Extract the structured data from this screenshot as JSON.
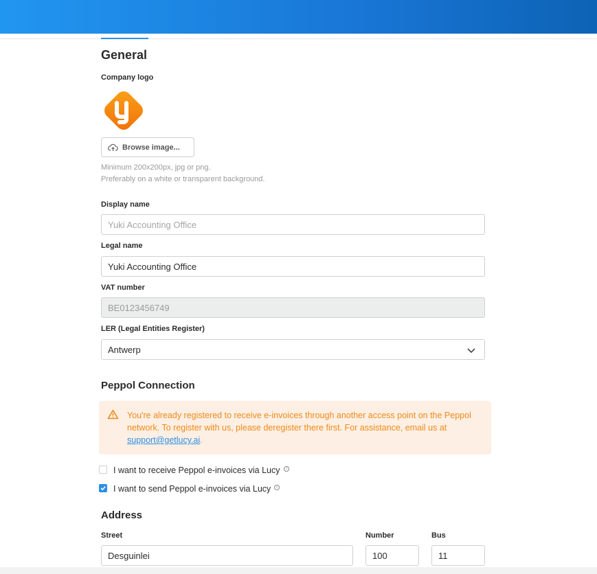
{
  "general": {
    "title": "General",
    "company_logo_label": "Company logo",
    "browse_label": "Browse image...",
    "hint_line1": "Minimum 200x200px, jpg or png.",
    "hint_line2": "Preferably on a white or transparent background.",
    "display_name": {
      "label": "Display name",
      "value": "",
      "placeholder": "Yuki Accounting Office"
    },
    "legal_name": {
      "label": "Legal name",
      "value": "Yuki Accounting Office"
    },
    "vat_number": {
      "label": "VAT number",
      "value": "BE0123456749"
    },
    "ler": {
      "label": "LER (Legal Entities Register)",
      "selected": "Antwerp"
    }
  },
  "peppol": {
    "title": "Peppol Connection",
    "warning_line1": "You're already registered to receive e-invoices through another access point on the Peppol",
    "warning_line2": "network. To register with us, please deregister there first. For assistance, email us at",
    "warning_link": "support@getlucy.ai",
    "warning_suffix": ".",
    "receive_label": "I want to receive Peppol e-invoices via Lucy",
    "receive_checked": false,
    "send_label": "I want to send Peppol e-invoices via Lucy",
    "send_checked": true
  },
  "address": {
    "title": "Address",
    "street_label": "Street",
    "street_value": "Desguinlei",
    "number_label": "Number",
    "number_value": "100",
    "bus_label": "Bus",
    "bus_value": "11"
  },
  "icons": {
    "logo": "yuki-logo",
    "upload": "cloud-upload-icon",
    "warning": "warning-triangle-icon",
    "info": "info-icon",
    "chevron": "chevron-down-icon"
  },
  "colors": {
    "accent": "#2b8fe6",
    "warning_text": "#ef8a18",
    "warning_bg": "#fdefe3",
    "logo_orange": "#f58a0b"
  }
}
